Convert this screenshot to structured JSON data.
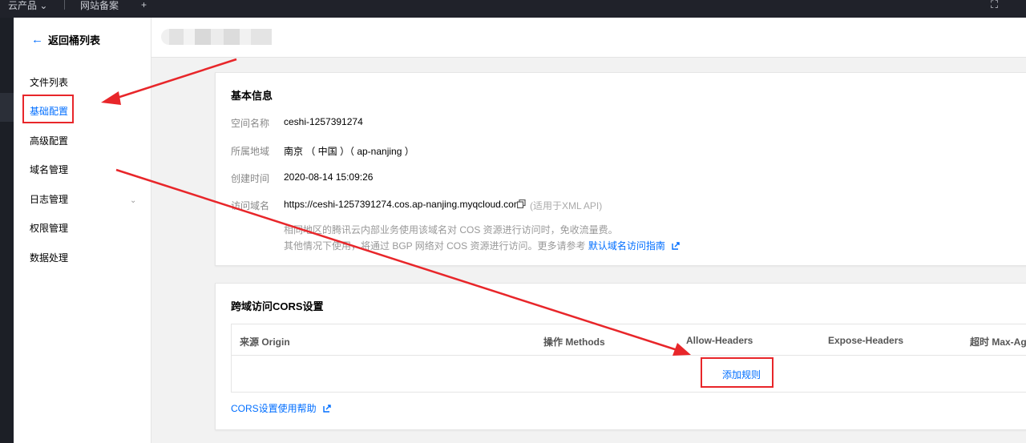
{
  "topbar": {
    "item1": "云产品 ⌄",
    "item2": "网站备案",
    "item3": "+",
    "item4": "⛶"
  },
  "sidebar": {
    "back_label": "返回桶列表",
    "items": [
      {
        "label": "文件列表"
      },
      {
        "label": "基础配置",
        "active": true
      },
      {
        "label": "高级配置"
      },
      {
        "label": "域名管理"
      },
      {
        "label": "日志管理"
      },
      {
        "label": "权限管理"
      },
      {
        "label": "数据处理"
      }
    ]
  },
  "basic_info": {
    "title": "基本信息",
    "rows": [
      {
        "label": "空间名称",
        "value": "ceshi-1257391274"
      },
      {
        "label": "所属地域",
        "value": "南京 （ 中国 ）（ ap-nanjing ）"
      },
      {
        "label": "创建时间",
        "value": "2020-08-14 15:09:26"
      },
      {
        "label": "访问域名",
        "value": "https://ceshi-1257391274.cos.ap-nanjing.myqcloud.com"
      }
    ],
    "api_note": "(适用于XML API)",
    "note1": "相同地区的腾讯云内部业务使用该域名对 COS 资源进行访问时，免收流量费。",
    "note2_prefix": "其他情况下使用，将通过 BGP 网络对 COS 资源进行访问。更多请参考",
    "note2_link": "默认域名访问指南"
  },
  "cors": {
    "title": "跨域访问CORS设置",
    "columns": [
      "来源 Origin",
      "操作 Methods",
      "Allow-Headers",
      "Expose-Headers",
      "超时 Max-Age"
    ],
    "add_rule": "添加规则",
    "help_link": "CORS设置使用帮助"
  },
  "colors": {
    "accent": "#006eff",
    "highlight": "#e8262a",
    "topbar": "#20222a"
  }
}
